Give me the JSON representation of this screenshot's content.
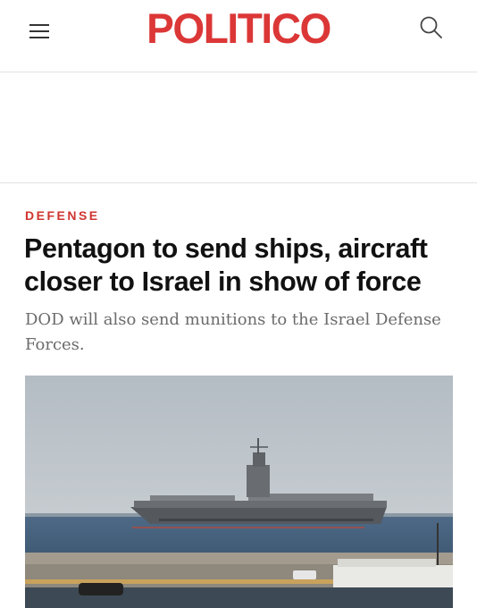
{
  "header": {
    "logo_text": "POLITICO",
    "menu_icon": "hamburger-menu-icon",
    "search_icon": "search-icon",
    "brand_color": "#dc3737"
  },
  "article": {
    "section": "DEFENSE",
    "headline": "Pentagon to send ships, aircraft closer to Israel in show of force",
    "dek": "DOD will also send munitions to the Israel Defense Forces."
  },
  "colors": {
    "section_label": "#d0352f",
    "headline": "#111111",
    "dek": "#6b6b6b"
  }
}
